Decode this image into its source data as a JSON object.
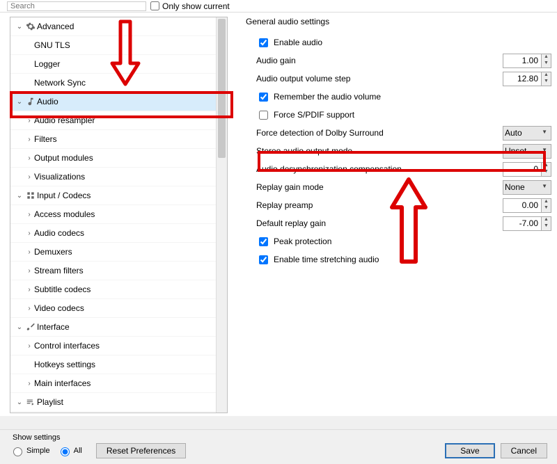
{
  "topbar": {
    "search_placeholder": "Search",
    "only_show_current": "Only show current"
  },
  "tree": {
    "advanced": "Advanced",
    "gnu_tls": "GNU TLS",
    "logger": "Logger",
    "network_sync": "Network Sync",
    "audio": "Audio",
    "audio_resampler": "Audio resampler",
    "filters": "Filters",
    "output_modules": "Output modules",
    "visualizations": "Visualizations",
    "input_codecs": "Input / Codecs",
    "access_modules": "Access modules",
    "audio_codecs": "Audio codecs",
    "demuxers": "Demuxers",
    "stream_filters": "Stream filters",
    "subtitle_codecs": "Subtitle codecs",
    "video_codecs": "Video codecs",
    "interface": "Interface",
    "control_interfaces": "Control interfaces",
    "hotkeys_settings": "Hotkeys settings",
    "main_interfaces": "Main interfaces",
    "playlist": "Playlist"
  },
  "panel": {
    "title": "General audio settings",
    "enable_audio": "Enable audio",
    "audio_gain": "Audio gain",
    "audio_gain_val": "1.00",
    "volume_step": "Audio output volume step",
    "volume_step_val": "12.80",
    "remember_volume": "Remember the audio volume",
    "force_spdif": "Force S/PDIF support",
    "force_dolby": "Force detection of Dolby Surround",
    "force_dolby_val": "Auto",
    "stereo_mode": "Stereo audio output mode",
    "stereo_mode_val": "Unset",
    "desync": "Audio desynchronization compensation",
    "desync_val": "0",
    "replay_mode": "Replay gain mode",
    "replay_mode_val": "None",
    "replay_preamp": "Replay preamp",
    "replay_preamp_val": "0.00",
    "default_replay": "Default replay gain",
    "default_replay_val": "-7.00",
    "peak_protection": "Peak protection",
    "time_stretch": "Enable time stretching audio"
  },
  "bottom": {
    "show_settings": "Show settings",
    "simple": "Simple",
    "all": "All",
    "reset": "Reset Preferences",
    "save": "Save",
    "cancel": "Cancel"
  }
}
